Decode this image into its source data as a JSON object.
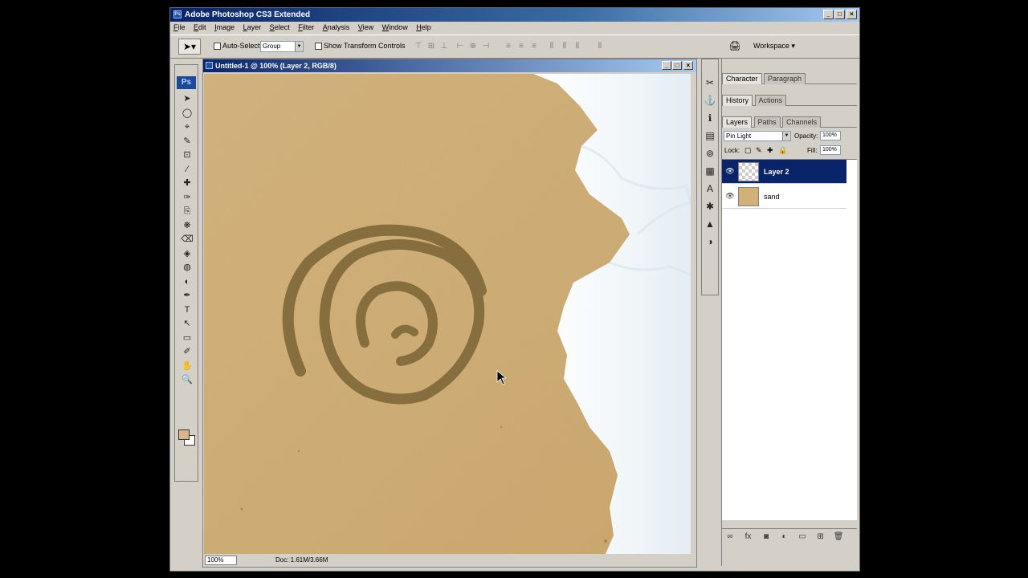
{
  "app": {
    "title": "Adobe Photoshop CS3 Extended",
    "title_icon": "Ps"
  },
  "window_buttons": {
    "minimize": "_",
    "maximize": "□",
    "close": "×"
  },
  "menu": [
    "File",
    "Edit",
    "Image",
    "Layer",
    "Select",
    "Filter",
    "Analysis",
    "View",
    "Window",
    "Help"
  ],
  "options": {
    "tool_icon": "move-tool-icon",
    "auto_select_label": "Auto-Select:",
    "auto_select_value": "Group",
    "show_transform_label": "Show Transform Controls",
    "workspace_label": "Workspace ▾"
  },
  "toolbox": {
    "logo": "Ps",
    "tools": [
      "➤",
      "◯",
      "⌖",
      "✎",
      "⊡",
      "∕",
      "✚",
      "✑",
      "⎘",
      "❋",
      "⌫",
      "◈",
      "◍",
      "◐",
      "✒",
      "T",
      "↖",
      "▭",
      "✐",
      "✋",
      "🔍"
    ]
  },
  "document": {
    "title": "Untitled-1 @ 100% (Layer 2, RGB/8)",
    "zoom": "100%",
    "doc_info": "Doc: 1.61M/3.66M"
  },
  "panels": {
    "tabs_top": [
      {
        "label": "Character",
        "active": true
      },
      {
        "label": "Paragraph",
        "active": false
      }
    ],
    "tabs_history": [
      {
        "label": "History",
        "active": true
      },
      {
        "label": "Actions",
        "active": false
      }
    ],
    "tabs_layers": [
      {
        "label": "Layers",
        "active": true
      },
      {
        "label": "Paths",
        "active": false
      },
      {
        "label": "Channels",
        "active": false
      }
    ],
    "blend_mode": "Pin Light",
    "opacity_label": "Opacity:",
    "opacity_value": "100%",
    "lock_label": "Lock:",
    "fill_label": "Fill:",
    "fill_value": "100%",
    "layers": [
      {
        "name": "Layer 2",
        "selected": true,
        "thumb": "transparent"
      },
      {
        "name": "sand",
        "selected": false,
        "thumb": "sand"
      }
    ]
  },
  "colors": {
    "title_gradient_start": "#0a246a",
    "title_gradient_end": "#a6caf0",
    "chrome": "#d4d0c8",
    "sand": "#d2b179",
    "foam": "#f4f8fb",
    "selection": "#0a246a"
  }
}
